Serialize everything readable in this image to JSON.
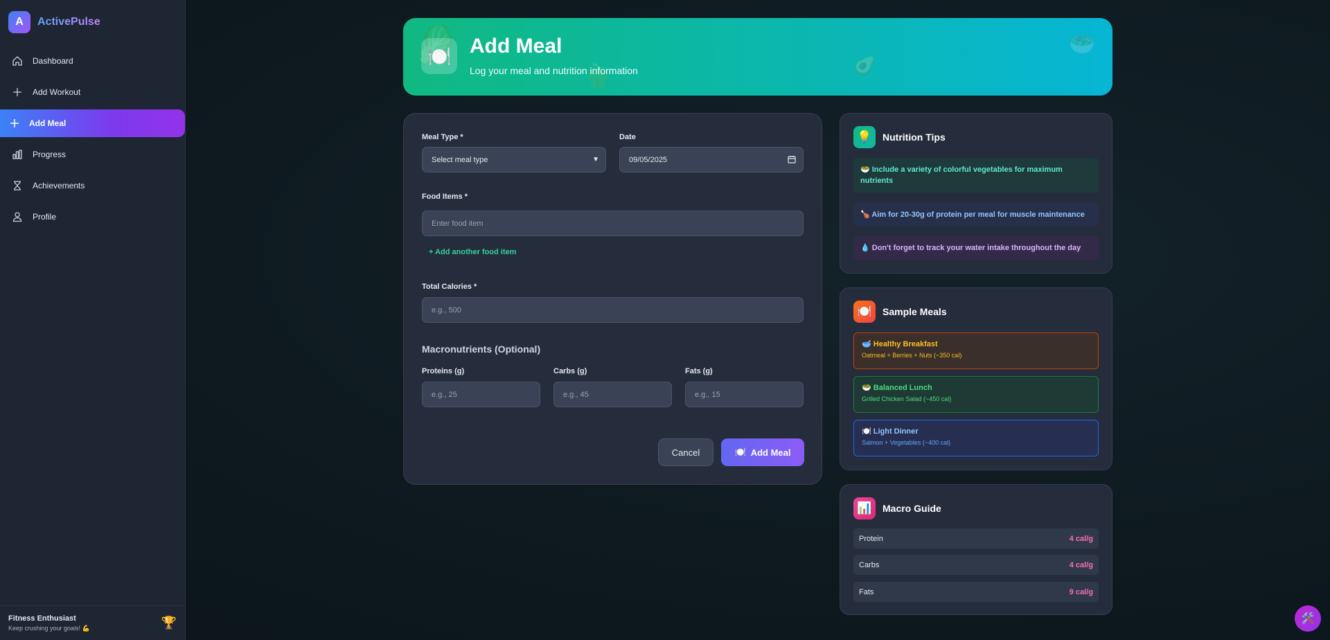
{
  "brand": {
    "logo_letter": "A",
    "name": "ActivePulse"
  },
  "sidebar": {
    "items": [
      {
        "label": "Dashboard",
        "icon": "home-icon"
      },
      {
        "label": "Add Workout",
        "icon": "plus-icon"
      },
      {
        "label": "Add Meal",
        "icon": "plus-icon",
        "active": true
      },
      {
        "label": "Progress",
        "icon": "bar-chart-icon"
      },
      {
        "label": "Achievements",
        "icon": "hourglass-icon"
      },
      {
        "label": "Profile",
        "icon": "user-icon"
      }
    ],
    "footer": {
      "name": "Fitness Enthusiast",
      "tagline": "Keep crushing your goals! 💪",
      "badge": "🏆"
    }
  },
  "header": {
    "icon": "🍽️",
    "title": "Add Meal",
    "subtitle": "Log your meal and nutrition information"
  },
  "form": {
    "meal_type": {
      "label": "Meal Type *",
      "value": "Select meal type"
    },
    "date": {
      "label": "Date",
      "value": "09/05/2025"
    },
    "food_items": {
      "label": "Food Items *",
      "placeholder": "Enter food item",
      "add_link": "+ Add another food item"
    },
    "calories": {
      "label": "Total Calories *",
      "placeholder": "e.g., 500"
    },
    "macros_title": "Macronutrients (Optional)",
    "proteins": {
      "label": "Proteins (g)",
      "placeholder": "e.g., 25"
    },
    "carbs": {
      "label": "Carbs (g)",
      "placeholder": "e.g., 45"
    },
    "fats": {
      "label": "Fats (g)",
      "placeholder": "e.g., 15"
    },
    "cancel_label": "Cancel",
    "submit_icon": "🍽️",
    "submit_label": "Add Meal"
  },
  "tips": {
    "icon": "💡",
    "title": "Nutrition Tips",
    "items": [
      "🥗 Include a variety of colorful vegetables for maximum nutrients",
      "🍗 Aim for 20-30g of protein per meal for muscle maintenance",
      "💧 Don't forget to track your water intake throughout the day"
    ]
  },
  "samples": {
    "icon": "🍽️",
    "title": "Sample Meals",
    "items": [
      {
        "title": "🥣 Healthy Breakfast",
        "desc": "Oatmeal + Berries + Nuts (~350 cal)"
      },
      {
        "title": "🥗 Balanced Lunch",
        "desc": "Grilled Chicken Salad (~450 cal)"
      },
      {
        "title": "🍽️ Light Dinner",
        "desc": "Salmon + Vegetables (~400 cal)"
      }
    ]
  },
  "macro_guide": {
    "icon": "📊",
    "title": "Macro Guide",
    "rows": [
      {
        "name": "Protein",
        "value": "4 cal/g"
      },
      {
        "name": "Carbs",
        "value": "4 cal/g"
      },
      {
        "name": "Fats",
        "value": "9 cal/g"
      }
    ]
  },
  "fab_icon": "🛠️",
  "colors": {
    "accent_green": "#10b981",
    "accent_cyan": "#06b6d4",
    "accent_purple": "#8b5cf6",
    "pink": "#f472b6"
  }
}
